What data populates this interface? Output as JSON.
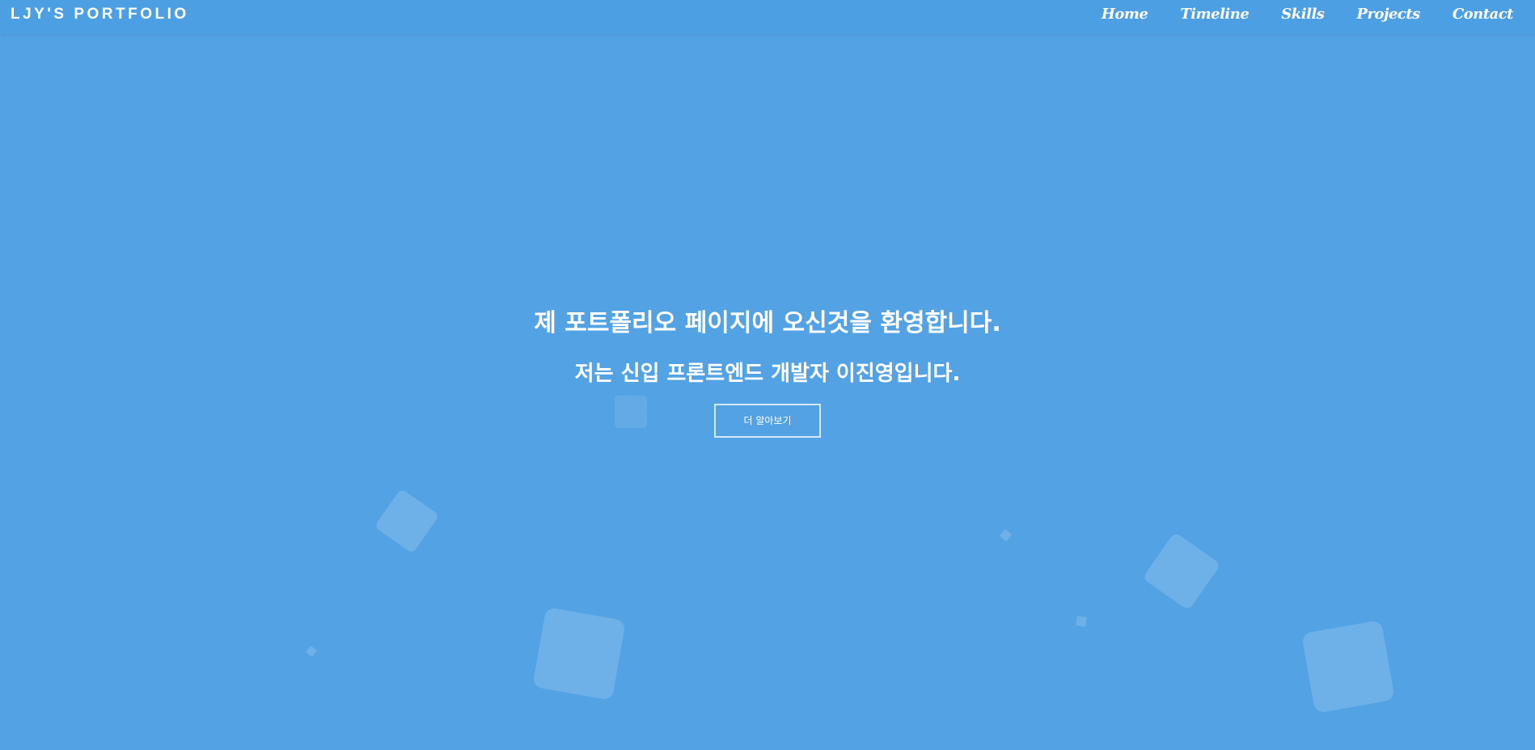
{
  "navbar": {
    "brand": "LJY'S PORTFOLIO",
    "links": [
      "Home",
      "Timeline",
      "Skills",
      "Projects",
      "Contact"
    ]
  },
  "hero": {
    "headline": "제 포트폴리오 페이지에 오신것을 환영합니다.",
    "subline": "저는 신입 프론트엔드 개발자 이진영입니다.",
    "cta_label": "더 알아보기"
  },
  "colors": {
    "background": "#52a2e4",
    "navbar": "#4d9fe3",
    "text": "#ffffff"
  }
}
